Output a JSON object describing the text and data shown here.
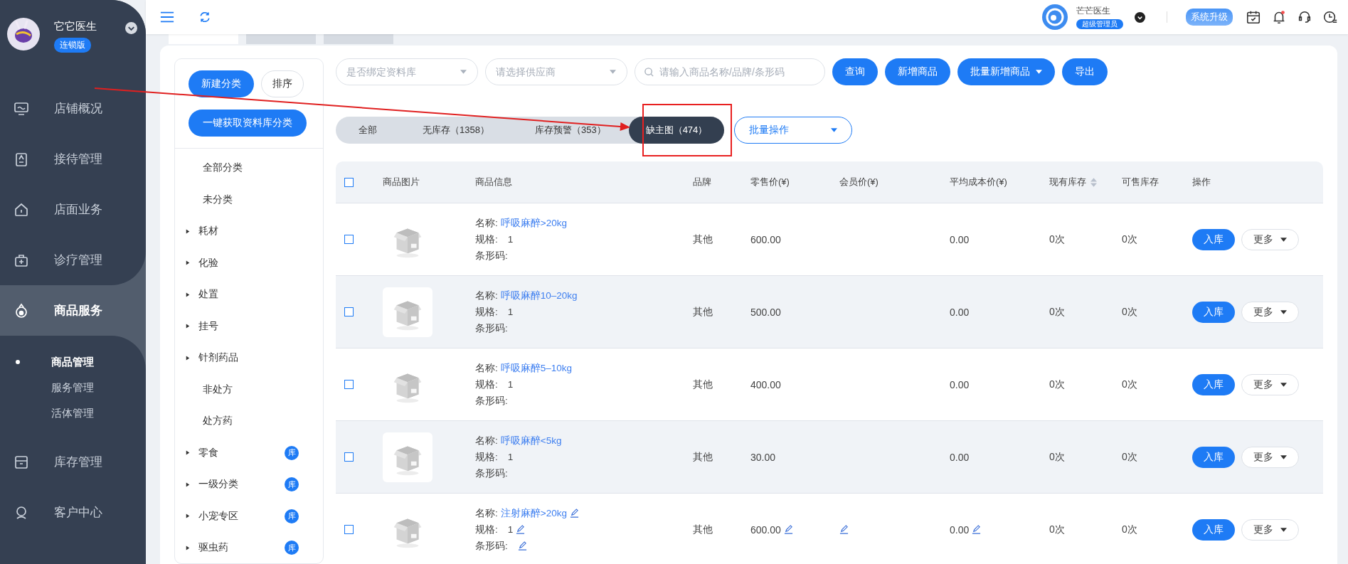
{
  "sidebar": {
    "clinic_name": "它它医生",
    "edition": "连锁版",
    "menu": [
      {
        "label": "店铺概况",
        "selected": false
      },
      {
        "label": "接待管理",
        "selected": false
      },
      {
        "label": "店面业务",
        "selected": false
      },
      {
        "label": "诊疗管理",
        "selected": false
      },
      {
        "label": "商品服务",
        "selected": true,
        "children": [
          {
            "label": "商品管理",
            "selected": true
          },
          {
            "label": "服务管理",
            "selected": false
          },
          {
            "label": "活体管理",
            "selected": false
          }
        ]
      },
      {
        "label": "库存管理",
        "selected": false
      },
      {
        "label": "客户中心",
        "selected": false
      }
    ]
  },
  "header": {
    "user_name": "芒芒医生",
    "role": "超级管理员",
    "upgrade_button": "系统升级",
    "unread_notifications": true
  },
  "page_tabs": [
    {
      "selected": true
    },
    {
      "selected": false
    },
    {
      "selected": false
    }
  ],
  "categories": {
    "new_button": "新建分类",
    "sort_button": "排序",
    "fetch_button": "一键获取资料库分类",
    "items": [
      {
        "label": "全部分类",
        "expandable": false
      },
      {
        "label": "未分类",
        "expandable": false
      },
      {
        "label": "耗材",
        "expandable": true
      },
      {
        "label": "化验",
        "expandable": true
      },
      {
        "label": "处置",
        "expandable": true
      },
      {
        "label": "挂号",
        "expandable": true
      },
      {
        "label": "针剂药品",
        "expandable": true
      },
      {
        "label": "非处方",
        "expandable": false
      },
      {
        "label": "处方药",
        "expandable": false
      },
      {
        "label": "零食",
        "expandable": true,
        "badge": "库"
      },
      {
        "label": "一级分类",
        "expandable": true,
        "badge": "库"
      },
      {
        "label": "小宠专区",
        "expandable": true,
        "badge": "库"
      },
      {
        "label": "驱虫药",
        "expandable": true,
        "badge": "库"
      }
    ]
  },
  "filters": {
    "library_select": {
      "placeholder": "是否绑定资料库"
    },
    "supplier_select": {
      "placeholder": "请选择供应商"
    },
    "search": {
      "placeholder": "请输入商品名称/品牌/条形码"
    },
    "buttons": [
      {
        "label": "查询",
        "dropdown": false
      },
      {
        "label": "新增商品",
        "dropdown": false
      },
      {
        "label": "批量新增商品",
        "dropdown": true
      },
      {
        "label": "导出",
        "dropdown": false
      }
    ]
  },
  "status_tabs": [
    {
      "label": "全部",
      "selected": false
    },
    {
      "label": "无库存（1358）",
      "selected": false
    },
    {
      "label": "库存预警（353）",
      "selected": false
    },
    {
      "label": "缺主图（474）",
      "selected": true
    }
  ],
  "batch_select": {
    "placeholder": "批量操作"
  },
  "markup": {
    "arrow": true,
    "frame": true
  },
  "table": {
    "all_checked": false,
    "columns": [
      {
        "label": "商品图片",
        "sortable": false
      },
      {
        "label": "商品信息",
        "sortable": false
      },
      {
        "label": "品牌",
        "sortable": false
      },
      {
        "label": "零售价(¥)",
        "sortable": false
      },
      {
        "label": "会员价(¥)",
        "sortable": false
      },
      {
        "label": "平均成本价(¥)",
        "sortable": false
      },
      {
        "label": "现有库存",
        "sortable": true
      },
      {
        "label": "可售库存",
        "sortable": false
      },
      {
        "label": "操作",
        "sortable": false
      }
    ],
    "rows": [
      {
        "checked": false,
        "name_label": "名称:",
        "name": "呼吸麻醉>20kg",
        "spec_label": "规格:",
        "spec": "1",
        "barcode_label": "条形码:",
        "brand": "其他",
        "retail_price": "600.00",
        "cost": "0.00",
        "stock": "0次",
        "sellable": "0次",
        "stock_in": "入库",
        "more": "更多",
        "editable": false
      },
      {
        "checked": false,
        "name_label": "名称:",
        "name": "呼吸麻醉10–20kg",
        "spec_label": "规格:",
        "spec": "1",
        "barcode_label": "条形码:",
        "brand": "其他",
        "retail_price": "500.00",
        "cost": "0.00",
        "stock": "0次",
        "sellable": "0次",
        "stock_in": "入库",
        "more": "更多",
        "editable": false
      },
      {
        "checked": false,
        "name_label": "名称:",
        "name": "呼吸麻醉5–10kg",
        "spec_label": "规格:",
        "spec": "1",
        "barcode_label": "条形码:",
        "brand": "其他",
        "retail_price": "400.00",
        "cost": "0.00",
        "stock": "0次",
        "sellable": "0次",
        "stock_in": "入库",
        "more": "更多",
        "editable": false
      },
      {
        "checked": false,
        "name_label": "名称:",
        "name": "呼吸麻醉<5kg",
        "spec_label": "规格:",
        "spec": "1",
        "barcode_label": "条形码:",
        "brand": "其他",
        "retail_price": "30.00",
        "cost": "0.00",
        "stock": "0次",
        "sellable": "0次",
        "stock_in": "入库",
        "more": "更多",
        "editable": false
      },
      {
        "checked": false,
        "name_label": "名称:",
        "name": "注射麻醉>20kg",
        "spec_label": "规格:",
        "spec": "1",
        "barcode_label": "条形码:",
        "brand": "其他",
        "retail_price": "600.00",
        "cost": "0.00",
        "stock": "0次",
        "sellable": "0次",
        "stock_in": "入库",
        "more": "更多",
        "editable": true
      }
    ]
  }
}
